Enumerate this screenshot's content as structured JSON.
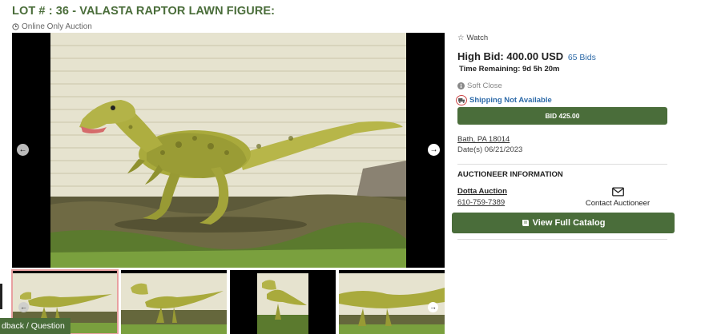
{
  "lot": {
    "title": "LOT # : 36 - VALASTA RAPTOR LAWN FIGURE:",
    "auction_type": "Online Only Auction"
  },
  "viewer": {
    "prev_icon": "arrow-left-circle-icon",
    "next_icon": "arrow-right-circle-icon"
  },
  "thumbnails": [
    {
      "name": "thumbnail-1",
      "active": true
    },
    {
      "name": "thumbnail-2",
      "active": false
    },
    {
      "name": "thumbnail-3",
      "active": false
    },
    {
      "name": "thumbnail-4",
      "active": false
    }
  ],
  "feedback": {
    "label": "dback / Question"
  },
  "sidebar": {
    "watch_label": "Watch",
    "high_bid_label": "High Bid: 400.00 USD",
    "bid_count": "65 Bids",
    "time_remaining": "Time Remaining: 9d 5h 20m",
    "soft_close": "Soft Close",
    "shipping": "Shipping Not Available",
    "bid_button": "BID 425.00",
    "location": "Bath, PA 18014",
    "dates": "Date(s) 06/21/2023",
    "auctioneer_heading": "AUCTIONEER INFORMATION",
    "auctioneer_name": "Dotta Auction",
    "auctioneer_phone": "610-759-7389",
    "contact_label": "Contact Auctioneer",
    "catalog_button": "View Full Catalog"
  },
  "colors": {
    "brand_green": "#4a6d3a",
    "link_blue": "#2d6aa8",
    "shipping_icon_red": "#cc4444"
  }
}
